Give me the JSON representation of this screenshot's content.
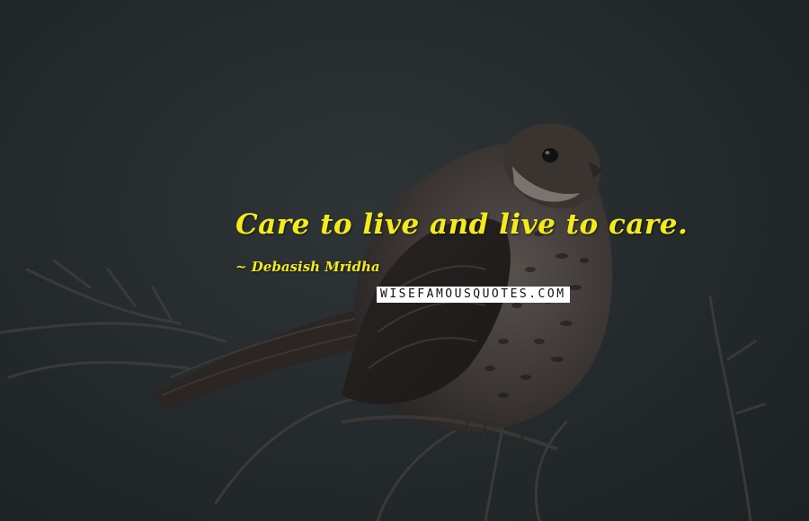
{
  "quote": {
    "text": "Care to live and live to care.",
    "author": "~ Debasish Mridha"
  },
  "watermark": {
    "text": "WISEFAMOUSQUOTES.COM"
  },
  "colors": {
    "quote_text": "#f4ea1c",
    "background": "#262c2e",
    "watermark_bg": "#ffffff",
    "watermark_text": "#111111"
  }
}
